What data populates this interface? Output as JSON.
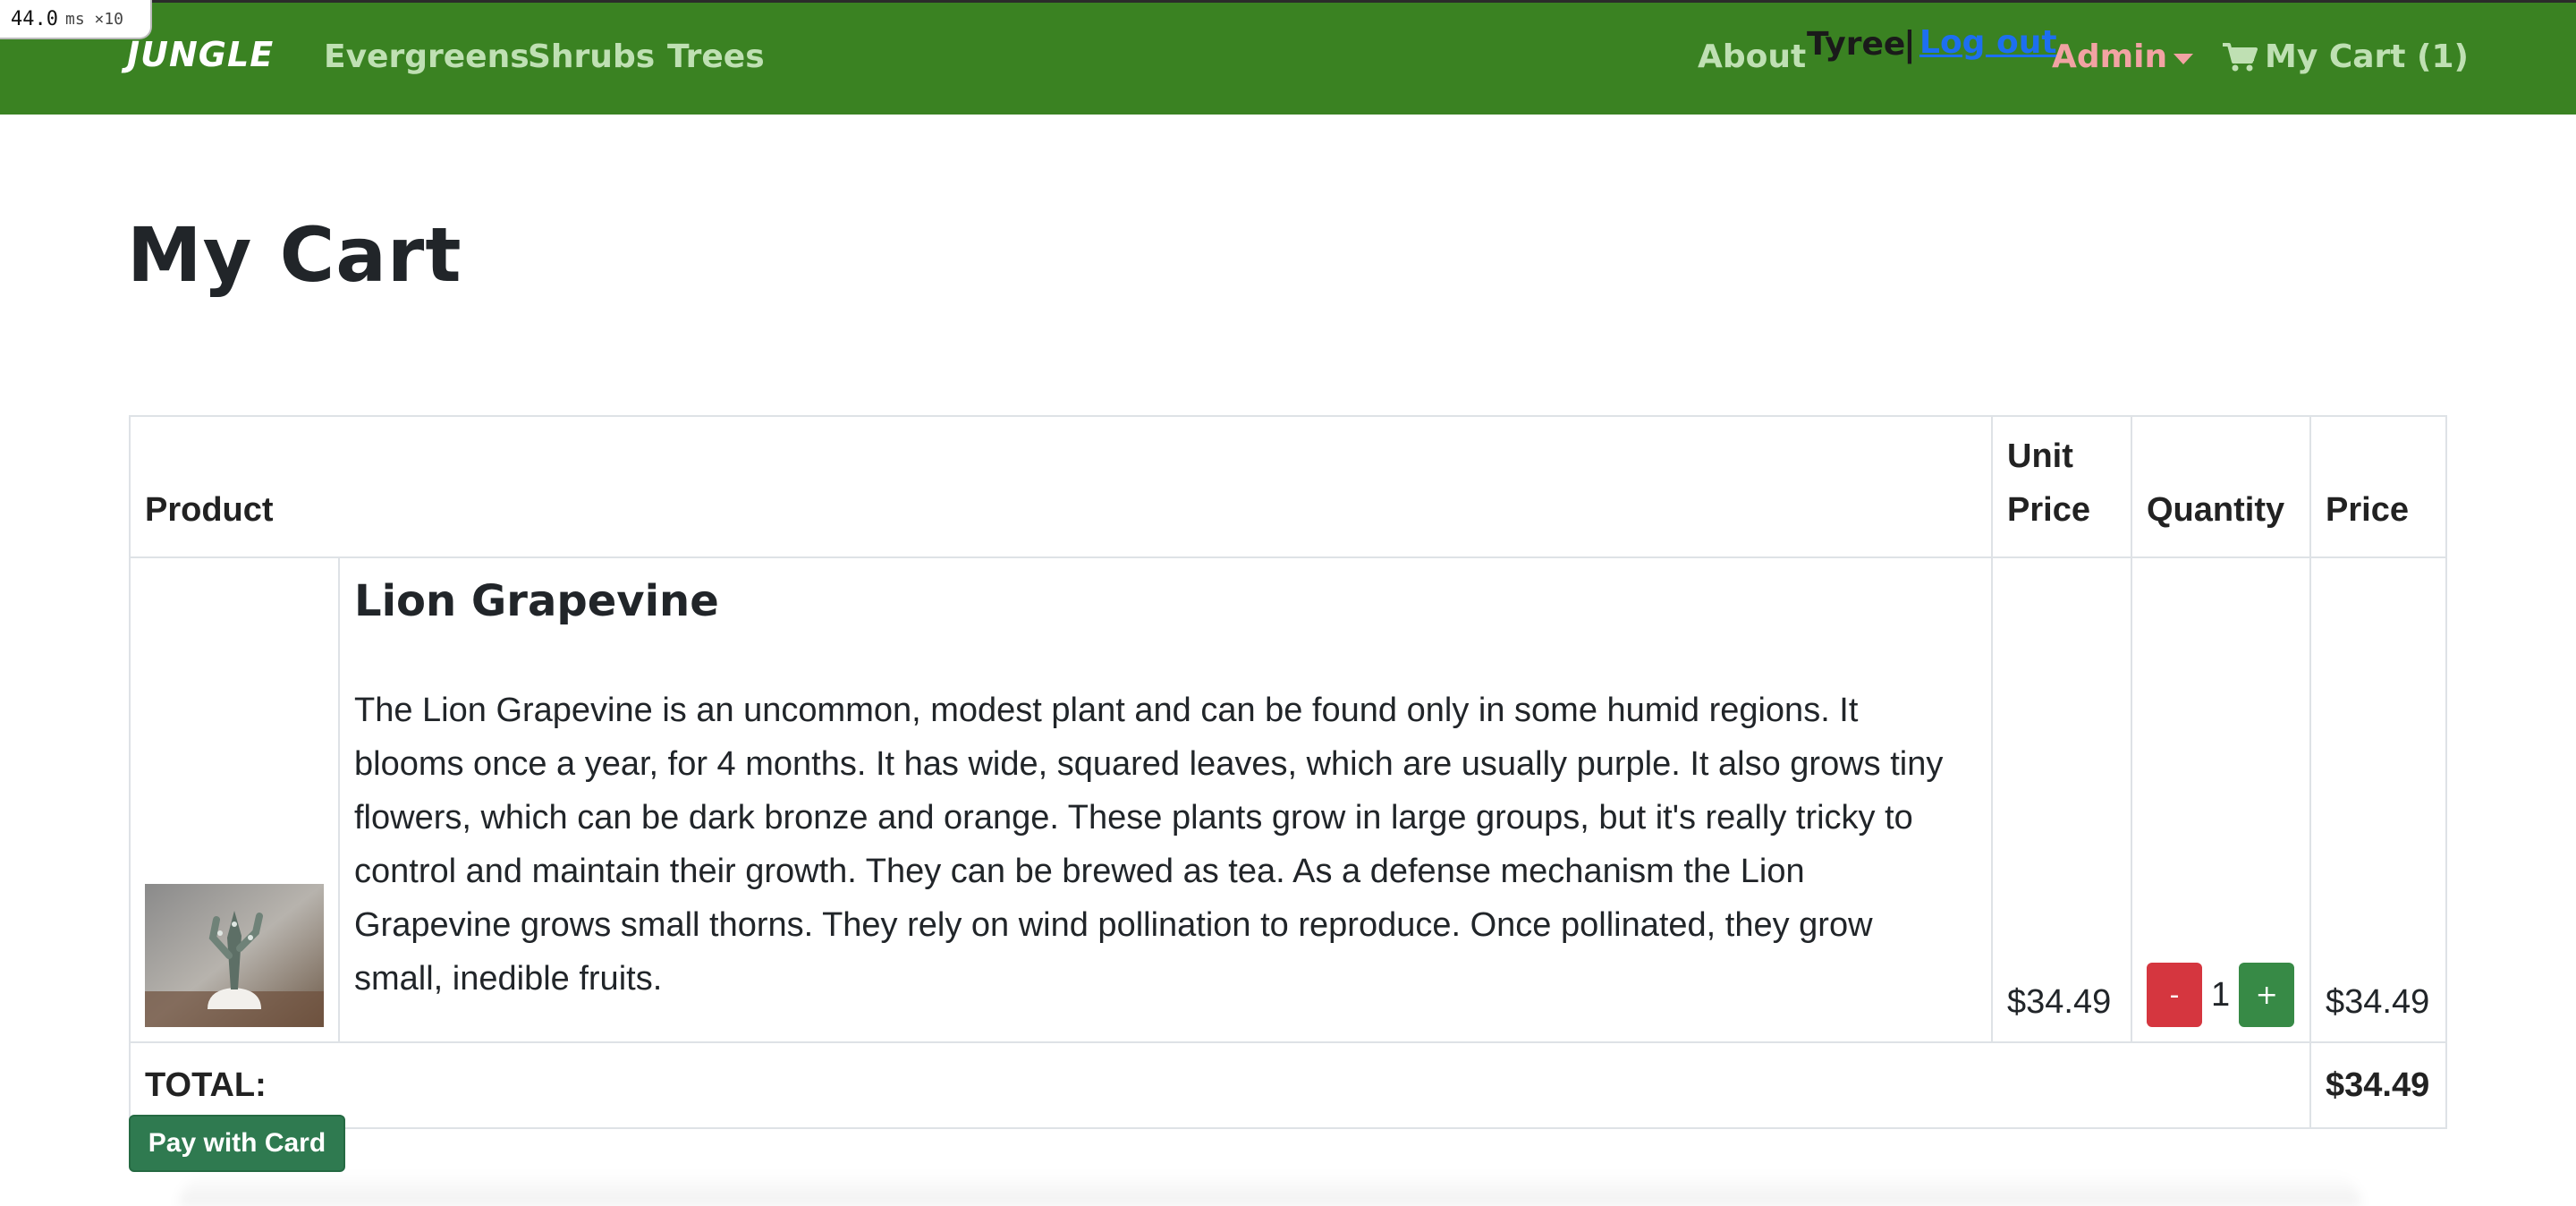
{
  "perf": {
    "value": "44.0",
    "unit": "ms ×10"
  },
  "navbar": {
    "brand": "JUNGLE",
    "links": [
      "Evergreens",
      "Shrubs",
      "Trees"
    ],
    "about": "About",
    "user": "Tyree",
    "separator": "|",
    "logout": "Log out",
    "admin": "Admin",
    "cart": "My Cart (1)"
  },
  "page": {
    "title": "My Cart"
  },
  "cart": {
    "headers": {
      "product": "Product",
      "unit_price": "Unit Price",
      "quantity": "Quantity",
      "price": "Price"
    },
    "items": [
      {
        "name": "Lion Grapevine",
        "description": "The Lion Grapevine is an uncommon, modest plant and can be found only in some humid regions. It blooms once a year, for 4 months. It has wide, squared leaves, which are usually purple. It also grows tiny flowers, which can be dark bronze and orange. These plants grow in large groups, but it's really tricky to control and maintain their growth. They can be brewed as tea. As a defense mechanism the Lion Grapevine grows small thorns. They rely on wind pollination to reproduce. Once pollinated, they grow small, inedible fruits.",
        "unit_price": "$34.49",
        "minus": "-",
        "quantity": "1",
        "plus": "+",
        "price": "$34.49"
      }
    ],
    "total_label": "TOTAL:",
    "total_value": "$34.49"
  },
  "pay_button": "Pay with Card",
  "colors": {
    "navbar": "#3a8222",
    "minus": "#d5363f",
    "plus": "#378a46",
    "pay": "#2f7a50"
  }
}
